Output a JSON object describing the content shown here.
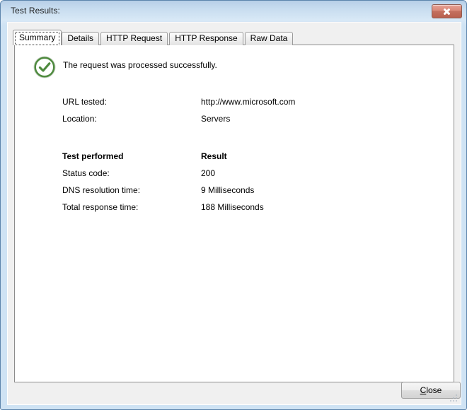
{
  "window": {
    "title": "Test Results:",
    "close_button_label": "Close window",
    "close_icon": "close-x-icon",
    "accent_title_blue": "#b4cde6",
    "close_button_red": "#d98878"
  },
  "tabs": [
    {
      "label": "Summary",
      "selected": true
    },
    {
      "label": "Details",
      "selected": false
    },
    {
      "label": "HTTP Request",
      "selected": false
    },
    {
      "label": "HTTP Response",
      "selected": false
    },
    {
      "label": "Raw Data",
      "selected": false
    }
  ],
  "summary": {
    "status_icon": "green-check-circle-icon",
    "status_icon_color": "#4e8a3e",
    "status_message": "The request was processed successfully.",
    "info_rows": [
      {
        "label": "URL tested:",
        "value": "http://www.microsoft.com",
        "bold": false
      },
      {
        "label": "Location:",
        "value": "Servers",
        "bold": false
      }
    ],
    "results_header": {
      "label": "Test performed",
      "value": "Result",
      "bold": true
    },
    "result_rows": [
      {
        "label": "Status code:",
        "value": "200",
        "bold": false
      },
      {
        "label": "DNS resolution time:",
        "value": "9 Milliseconds",
        "bold": false
      },
      {
        "label": "Total response time:",
        "value": "188 Milliseconds",
        "bold": false
      }
    ]
  },
  "footer": {
    "close_accel": "C",
    "close_rest": "lose"
  }
}
